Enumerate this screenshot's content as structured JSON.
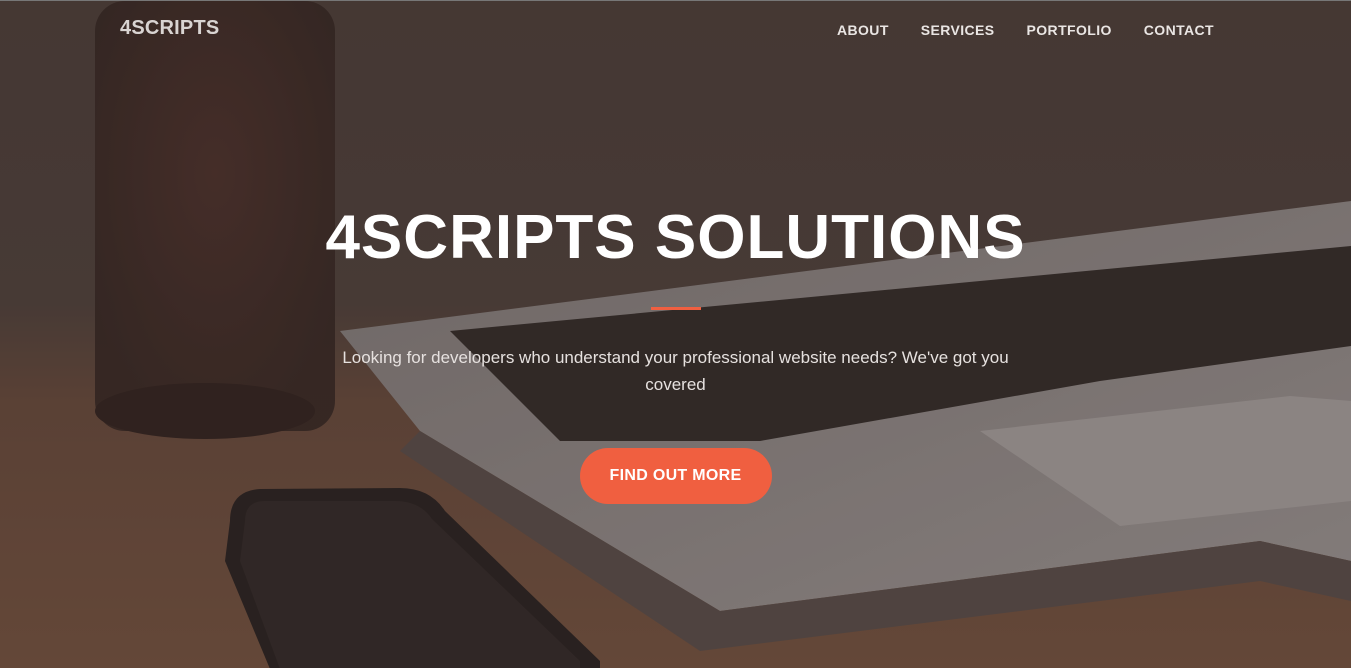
{
  "nav": {
    "brand": "4SCRIPTS",
    "links": [
      {
        "label": "ABOUT"
      },
      {
        "label": "SERVICES"
      },
      {
        "label": "PORTFOLIO"
      },
      {
        "label": "CONTACT"
      }
    ]
  },
  "hero": {
    "title": "4SCRIPTS SOLUTIONS",
    "subtitle": "Looking for developers who understand your professional website needs? We've got you covered",
    "cta_label": "FIND OUT MORE"
  },
  "colors": {
    "accent": "#f05f40",
    "overlay": "#3c302d"
  }
}
